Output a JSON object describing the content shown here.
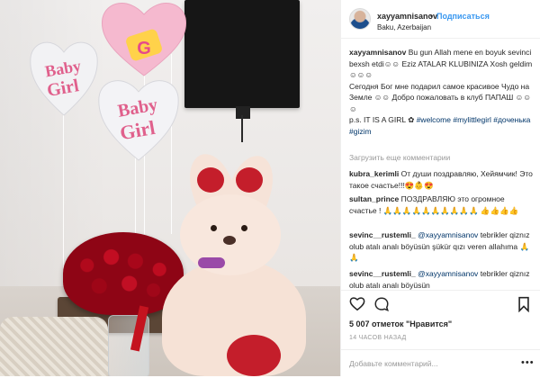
{
  "header": {
    "username": "xayyamnisanov",
    "separator": "•",
    "follow_label": "Подписаться",
    "location": "Baku, Azerbaijan"
  },
  "caption": {
    "username": "xayyamnisanov",
    "line1": "Bu gun Allah mene en boyuk sevinci bexsh etdi☺☺ Eziz ATALAR KLUBINIZA Xosh geldim☺☺☺",
    "line2": "Сегодня Бог мне подарил самое красивое Чудо на Земле ☺☺ Добро пожаловать в клуб ПАПАШ ☺☺☺",
    "line3_prefix": "p.s. IT IS A GIRL ✿",
    "hashtags": [
      "#welcome",
      "#mylittlegirl",
      "#доченька",
      "#gizim"
    ]
  },
  "load_more": "Загрузить еще комментарии",
  "comments": [
    {
      "username": "kubra_kerimli",
      "text": "От души поздравляю, Хейямчик! Это такое счастье!!!😍👶😍"
    },
    {
      "username": "sultan_prince",
      "text": "ПОЗДРАВЛЯЮ это огромное счастье ! 🙏🙏🙏🙏🙏🙏🙏🙏🙏🙏 👍👍👍👍"
    },
    {
      "username": "sevinc__rustemli_",
      "mention": "@xayyamnisanov",
      "text": "tebrikler qiznız olub atalı analı böyüsün şükür qızı veren allahıma 🙏🙏"
    },
    {
      "username": "sevinc__rustemli_",
      "mention": "@xayyamnisanov",
      "text": "tebrikler qiznız olub atalı analı böyüsün"
    }
  ],
  "likes": "5 007 отметок \"Нравится\"",
  "timestamp": "14 ЧАСОВ НАЗАД",
  "add_comment_placeholder": "Добавьте комментарий...",
  "more_label": "•••",
  "photo": {
    "balloon_text_1": "Baby Girl",
    "balloon_text_2": "Baby Girl",
    "balloon_letter": "G"
  },
  "colors": {
    "link_blue": "#3897f0",
    "hashtag_blue": "#003569",
    "rose_red": "#b1091c"
  },
  "icons": [
    "heart-icon",
    "comment-icon",
    "bookmark-icon"
  ]
}
